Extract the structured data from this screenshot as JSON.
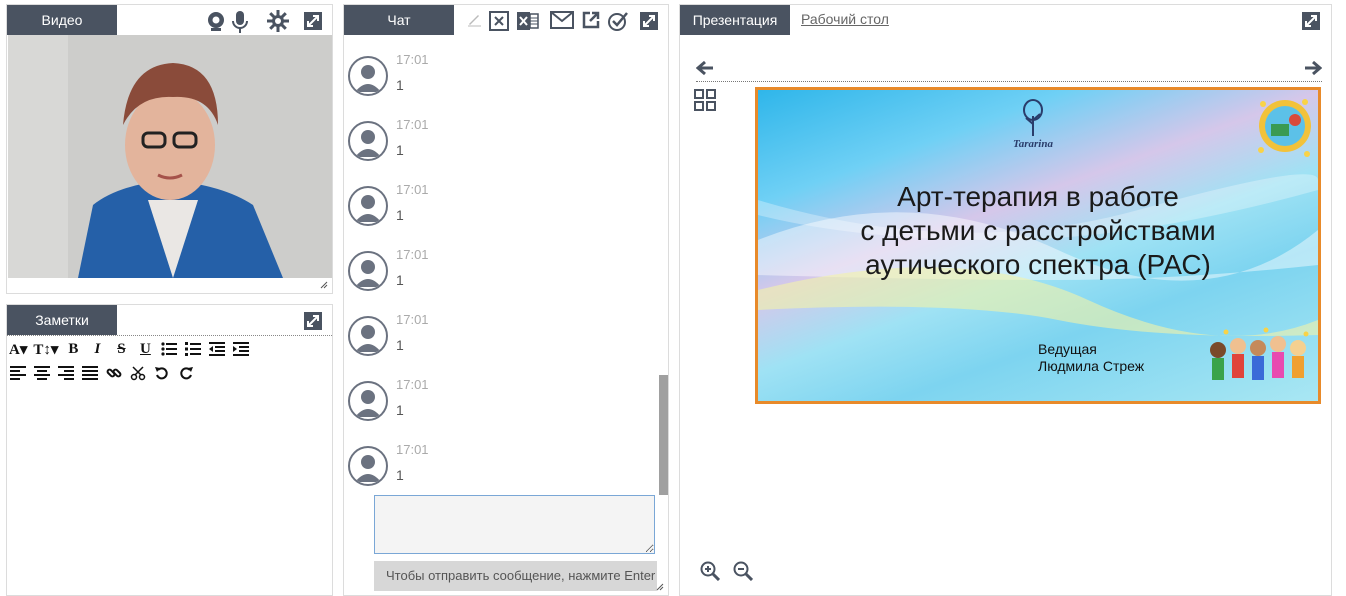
{
  "video": {
    "tab_label": "Видео"
  },
  "notes": {
    "tab_label": "Заметки"
  },
  "chat": {
    "tab_label": "Чат",
    "messages": [
      {
        "time": "17:01",
        "text": "1"
      },
      {
        "time": "17:01",
        "text": "1"
      },
      {
        "time": "17:01",
        "text": "1"
      },
      {
        "time": "17:01",
        "text": "1"
      },
      {
        "time": "17:01",
        "text": "1"
      },
      {
        "time": "17:01",
        "text": "1"
      },
      {
        "time": "17:01",
        "text": "1"
      }
    ],
    "input_value": "",
    "send_hint": "Чтобы отправить сообщение, нажмите Enter"
  },
  "presentation": {
    "tab_label": "Презентация",
    "desktop_tab_label": "Рабочий стол",
    "slide": {
      "logo_text": "Tararina",
      "title_line1": "Арт-терапия в работе",
      "title_line2": "с детьми с расстройствами",
      "title_line3": "аутического спектра (РАС)",
      "presenter_label": "Ведущая",
      "presenter_name": "Людмила Стреж"
    }
  },
  "colors": {
    "tab_bg": "#4a5361",
    "icon": "#4a5361",
    "slide_border": "#e88a2a"
  }
}
